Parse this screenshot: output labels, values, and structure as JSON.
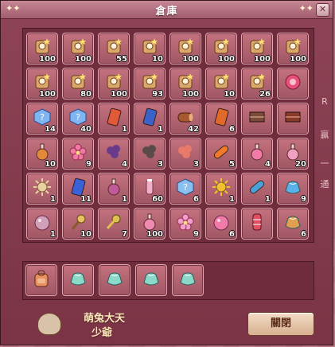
{
  "window": {
    "title": "倉庫"
  },
  "inventory": [
    {
      "icon": "scroll-icon",
      "qty": "100",
      "color": "#d9a86a"
    },
    {
      "icon": "scroll-icon",
      "qty": "100",
      "color": "#d9a86a"
    },
    {
      "icon": "scroll-icon",
      "qty": "55",
      "color": "#d9a86a"
    },
    {
      "icon": "scroll-icon",
      "qty": "10",
      "color": "#d9a86a"
    },
    {
      "icon": "scroll-icon",
      "qty": "100",
      "color": "#d9a86a"
    },
    {
      "icon": "scroll-icon",
      "qty": "100",
      "color": "#d9a86a"
    },
    {
      "icon": "scroll-icon",
      "qty": "100",
      "color": "#d9a86a"
    },
    {
      "icon": "scroll-icon",
      "qty": "100",
      "color": "#d9a86a"
    },
    {
      "icon": "scroll-icon",
      "qty": "100",
      "color": "#d9a86a"
    },
    {
      "icon": "scroll-icon",
      "qty": "80",
      "color": "#d9a86a"
    },
    {
      "icon": "scroll-icon",
      "qty": "100",
      "color": "#d9a86a"
    },
    {
      "icon": "scroll-icon",
      "qty": "93",
      "color": "#d9a86a"
    },
    {
      "icon": "scroll-icon",
      "qty": "100",
      "color": "#d9a86a"
    },
    {
      "icon": "scroll-icon",
      "qty": "10",
      "color": "#d9a86a"
    },
    {
      "icon": "scroll-icon",
      "qty": "26",
      "color": "#d9a86a"
    },
    {
      "icon": "ribbon-icon",
      "qty": "",
      "color": "#e8507a"
    },
    {
      "icon": "mystery-box-icon",
      "qty": "14",
      "color": "#7fb6f2"
    },
    {
      "icon": "mystery-box-icon",
      "qty": "40",
      "color": "#7fb6f2"
    },
    {
      "icon": "card-icon",
      "qty": "1",
      "color": "#e05a3a"
    },
    {
      "icon": "card-icon",
      "qty": "1",
      "color": "#3a62c8"
    },
    {
      "icon": "log-icon",
      "qty": "42",
      "color": "#a8582e"
    },
    {
      "icon": "card-icon",
      "qty": "6",
      "color": "#e06a2a"
    },
    {
      "icon": "book-icon",
      "qty": "",
      "color": "#7a4a3a"
    },
    {
      "icon": "book-icon",
      "qty": "",
      "color": "#8a3a2a"
    },
    {
      "icon": "potion-icon",
      "qty": "10",
      "color": "#e08a3a"
    },
    {
      "icon": "flower-icon",
      "qty": "9",
      "color": "#f07aa0"
    },
    {
      "icon": "smoke-icon",
      "qty": "4",
      "color": "#6a3a8a"
    },
    {
      "icon": "smoke-icon",
      "qty": "3",
      "color": "#5a4a4a"
    },
    {
      "icon": "smoke-icon",
      "qty": "3",
      "color": "#e87a6a"
    },
    {
      "icon": "capsule-icon",
      "qty": "5",
      "color": "#f07a2a"
    },
    {
      "icon": "potion-icon",
      "qty": "4",
      "color": "#f07aa8"
    },
    {
      "icon": "potion-icon",
      "qty": "20",
      "color": "#f0a0c0"
    },
    {
      "icon": "sun-icon",
      "qty": "1",
      "color": "#e8d0a0"
    },
    {
      "icon": "card-icon",
      "qty": "11",
      "color": "#3a62d8"
    },
    {
      "icon": "potion-icon",
      "qty": "1",
      "color": "#c05a9a"
    },
    {
      "icon": "bottle-icon",
      "qty": "60",
      "color": "#f0b0c8"
    },
    {
      "icon": "mystery-box-icon",
      "qty": "6",
      "color": "#8ac0f0"
    },
    {
      "icon": "sun-icon",
      "qty": "1",
      "color": "#f0c030"
    },
    {
      "icon": "capsule-icon",
      "qty": "1",
      "color": "#4aa0d8"
    },
    {
      "icon": "pouch-icon",
      "qty": "9",
      "color": "#5ab0e8"
    },
    {
      "icon": "orb-icon",
      "qty": "1",
      "color": "#d0a0b8"
    },
    {
      "icon": "paw-wand-icon",
      "qty": "10",
      "color": "#e8c060"
    },
    {
      "icon": "key-icon",
      "qty": "7",
      "color": "#e0c050"
    },
    {
      "icon": "potion-icon",
      "qty": "100",
      "color": "#f08ab0"
    },
    {
      "icon": "flower-icon",
      "qty": "9",
      "color": "#f0a0c8"
    },
    {
      "icon": "orb-icon",
      "qty": "6",
      "color": "#f07aa8"
    },
    {
      "icon": "candy-icon",
      "qty": "",
      "color": "#e05060"
    },
    {
      "icon": "pouch-icon",
      "qty": "6",
      "color": "#e0a050"
    }
  ],
  "bottom_slots": [
    {
      "icon": "backpack-icon",
      "color": "#e89060"
    },
    {
      "icon": "pouch-icon",
      "color": "#8ad8c8"
    },
    {
      "icon": "pouch-icon",
      "color": "#8ad8c8"
    },
    {
      "icon": "pouch-icon",
      "color": "#8ad8c8"
    },
    {
      "icon": "pouch-icon",
      "color": "#8ad8c8"
    }
  ],
  "side_labels": [
    "R",
    "贏",
    "一",
    "通"
  ],
  "footer": {
    "line1": "萌兔大天",
    "line2": "少爺"
  },
  "close_button": "關閉"
}
